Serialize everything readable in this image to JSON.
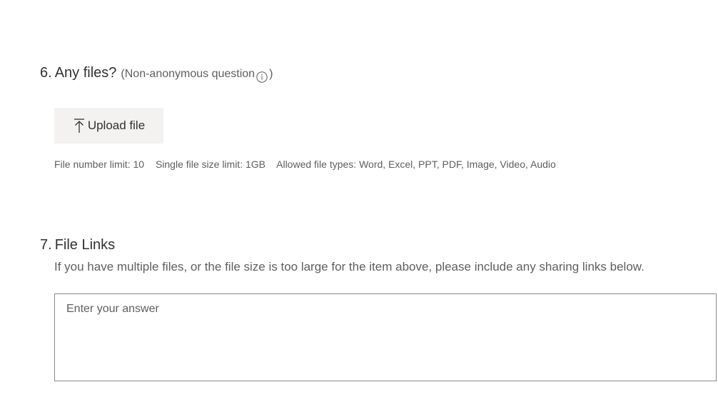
{
  "questions": [
    {
      "number": "6.",
      "title": "Any files?",
      "note_open": "(Non-anonymous question",
      "note_close": ")",
      "upload_label": "Upload file",
      "limits": {
        "count": "File number limit: 10",
        "size": "Single file size limit: 1GB",
        "types": "Allowed file types: Word, Excel, PPT, PDF, Image, Video, Audio"
      }
    },
    {
      "number": "7.",
      "title": "File Links",
      "subtitle": "If you have multiple files, or the file size is too large for the item above, please include any sharing links below.",
      "placeholder": "Enter your answer"
    }
  ],
  "icons": {
    "info": "info-icon",
    "upload": "upload-icon"
  }
}
